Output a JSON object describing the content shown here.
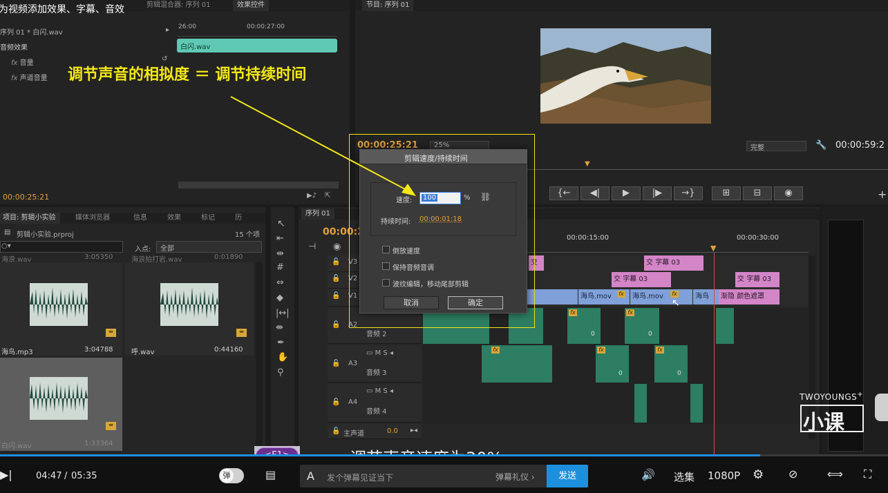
{
  "lesson_title": "为视频添加效果、字幕、音效",
  "top_tabs": {
    "mixer": "剪辑混合器: 序列 01",
    "effect_controls": "效果控件",
    "program": "节目: 序列 01"
  },
  "effect_controls": {
    "clip_path": "序列 01 * 白闪.wav",
    "time_start": "26:00",
    "time_mid": "00:00:27:00",
    "section": "音频效果",
    "fx1": "音量",
    "fx2": "声道音量",
    "clip_name": "白闪.wav",
    "timecode": "00:00:25:21"
  },
  "annotation": {
    "headline": "调节声音的相拟度 ＝ 调节持续时间"
  },
  "program_monitor": {
    "timecode": "00:00:25:21",
    "zoom": "25%",
    "quality": "完整",
    "duration": "00:00:59:2"
  },
  "project": {
    "tabs": [
      "项目: 剪辑小实验",
      "媒体浏览器",
      "信息",
      "效果",
      "标记",
      "历"
    ],
    "filename": "剪辑小实验.prproj",
    "item_count": "15 个项",
    "entry_label": "入点:",
    "entry_value": "全部",
    "prev_row_left": "海浪.wav",
    "prev_row_left_dur": "3:05350",
    "prev_row_right": "海浪拍打岩.wav",
    "prev_row_right_dur": "0:01890",
    "items": [
      {
        "name": "海鸟.mp3",
        "duration": "3:04788"
      },
      {
        "name": "呼.wav",
        "duration": "0:44160"
      },
      {
        "name": "白闪.wav",
        "duration": "1:33364"
      }
    ]
  },
  "timeline": {
    "tab": "序列 01",
    "timecode": "00:00:2",
    "ruler": [
      "00:00:15:00",
      "00:00:30:00"
    ],
    "tracks": {
      "v3": "V3",
      "v2": "V2",
      "v1": "V1",
      "a2": "A2",
      "a3": "A3",
      "a4": "A4",
      "master": "主声道",
      "master_val": "0.0"
    },
    "track_names": {
      "a2": "音频 2",
      "a3": "音频 3",
      "a4": "音频 4"
    },
    "clips": {
      "jiao": "交",
      "zimu03": "字幕 03",
      "hainiao": "海鸟.mov",
      "hainiao_short": "海鸟",
      "jianyin": "渐隐",
      "yanse": "颜色遮罩",
      "zero": "0",
      "fx": "fx"
    }
  },
  "dialog": {
    "title": "剪辑速度/持续时间",
    "speed_label": "速度:",
    "speed_value": "100",
    "percent": "%",
    "duration_label": "持续时间:",
    "duration_value": "00:00:01:18",
    "reverse": "倒放速度",
    "keep_pitch": "保持音频音调",
    "ripple": "波纹编辑，移动尾部剪辑",
    "cancel": "取消",
    "ok": "确定"
  },
  "subtitle": "调节声音速度为30%",
  "f1_badge": "<F1>",
  "watermark": {
    "brand": "TWOYOUNGS",
    "plus": "+",
    "logo": "小课"
  },
  "player": {
    "current": "04:47",
    "sep": "/",
    "total": "05:35",
    "danmu_toggle": "弹",
    "danmu_placeholder": "发个弹幕见证当下",
    "danmu_gift": "弹幕礼仪",
    "send": "发送",
    "episodes": "选集",
    "quality": "1080P"
  },
  "colors": {
    "accent_blue": "#1e8fdd",
    "timecode_orange": "#e3a03a",
    "annotation_yellow": "#f3e818"
  }
}
